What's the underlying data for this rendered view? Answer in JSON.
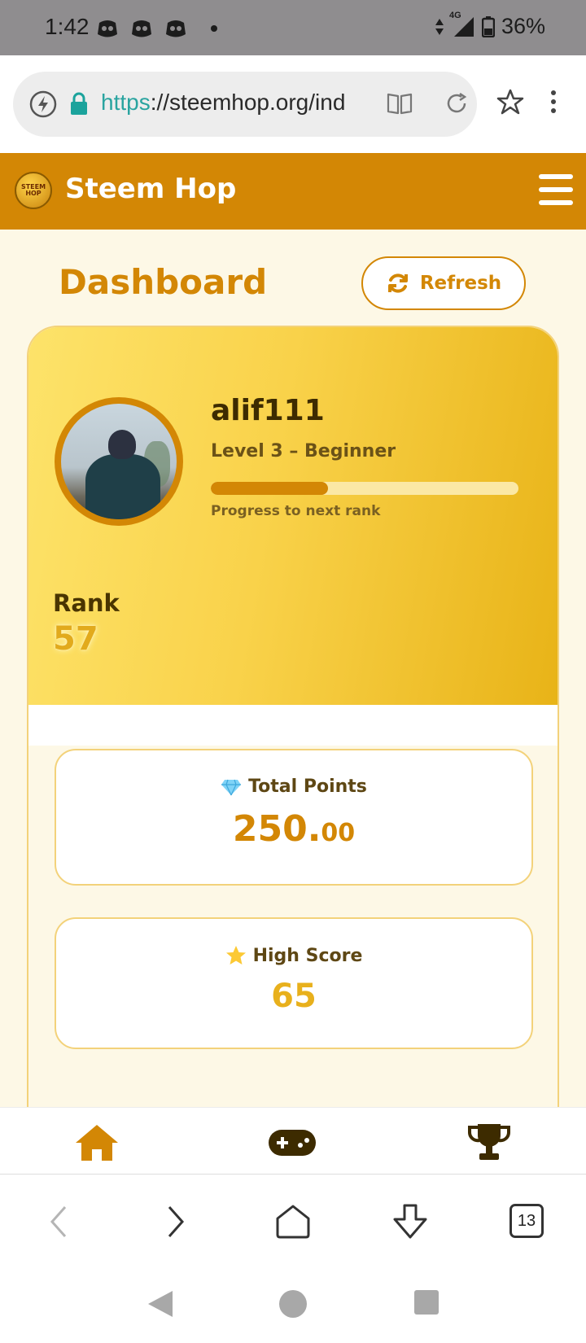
{
  "status_bar": {
    "time": "1:42",
    "network": "4G",
    "battery": "36%",
    "notification_icons": [
      "discord-icon",
      "discord-icon",
      "discord-icon"
    ]
  },
  "browser": {
    "url_scheme": "https",
    "url_rest": "://steemhop.org/ind",
    "tab_count": "13"
  },
  "app": {
    "brand": "Steem Hop",
    "logo_text": "STEEM HOP",
    "accent_color": "#d38705"
  },
  "dashboard": {
    "title": "Dashboard",
    "refresh_label": "Refresh"
  },
  "profile": {
    "username": "alif111",
    "level_text": "Level 3 – Beginner",
    "progress_fraction": 0.38,
    "progress_label": "Progress to next rank",
    "rank_label": "Rank",
    "rank_value": "57"
  },
  "stats": {
    "total_points_label": "Total Points",
    "total_points_int": "250.",
    "total_points_dec": "00",
    "high_score_label": "High Score",
    "high_score_value": "65"
  },
  "bottom_nav": {
    "items": [
      "home-icon",
      "gamepad-icon",
      "trophy-icon"
    ]
  }
}
